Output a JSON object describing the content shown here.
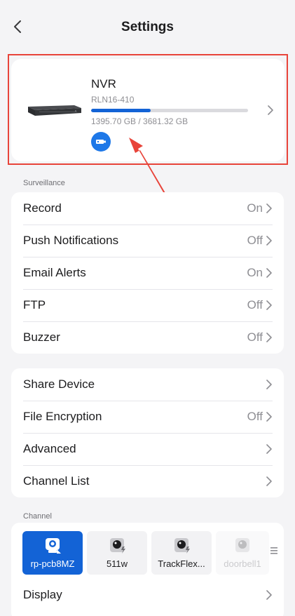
{
  "header": {
    "title": "Settings"
  },
  "device": {
    "name": "NVR",
    "model": "RLN16-410",
    "storage_text": "1395.70 GB / 3681.32 GB",
    "storage_used_fraction": 0.379,
    "accent_color": "#1363d6",
    "highlight_color": "#e8443a"
  },
  "surveillance": {
    "label": "Surveillance",
    "items": [
      {
        "label": "Record",
        "value": "On"
      },
      {
        "label": "Push Notifications",
        "value": "Off"
      },
      {
        "label": "Email Alerts",
        "value": "On"
      },
      {
        "label": "FTP",
        "value": "Off"
      },
      {
        "label": "Buzzer",
        "value": "Off"
      }
    ]
  },
  "general": {
    "items": [
      {
        "label": "Share Device",
        "value": ""
      },
      {
        "label": "File Encryption",
        "value": "Off"
      },
      {
        "label": "Advanced",
        "value": ""
      },
      {
        "label": "Channel List",
        "value": ""
      }
    ]
  },
  "channel": {
    "label": "Channel",
    "channels": [
      {
        "name": "rp-pcb8MZ",
        "icon": "camera-icon",
        "state": "selected"
      },
      {
        "name": "511w",
        "icon": "battery-camera-icon",
        "state": "normal"
      },
      {
        "name": "TrackFlex...",
        "icon": "battery-camera-icon",
        "state": "normal"
      },
      {
        "name": "doorbell1",
        "icon": "doorbell-camera-icon",
        "state": "offline"
      }
    ],
    "display_label": "Display"
  }
}
